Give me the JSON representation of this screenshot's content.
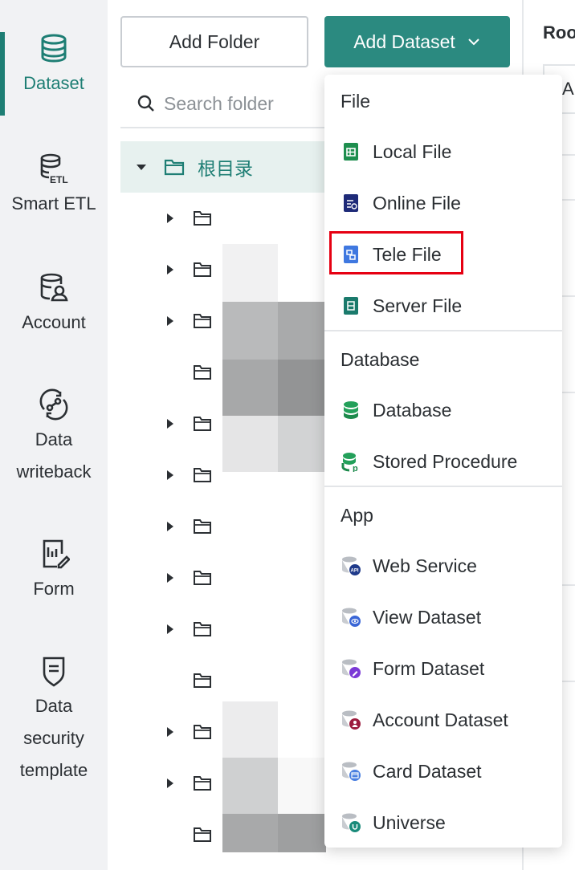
{
  "sidebar": {
    "items": [
      {
        "label": "Dataset",
        "icon": "database-icon",
        "active": true
      },
      {
        "label": "Smart ETL",
        "icon": "etl-icon"
      },
      {
        "label": "Account",
        "icon": "account-icon"
      },
      {
        "label": "Data writeback",
        "icon": "writeback-icon"
      },
      {
        "label": "Form",
        "icon": "form-icon"
      },
      {
        "label": "Data security template",
        "icon": "shield-icon"
      }
    ]
  },
  "toolbar": {
    "add_folder_label": "Add Folder",
    "add_dataset_label": "Add Dataset"
  },
  "search": {
    "placeholder": "Search folder"
  },
  "tree": {
    "root_label": "根目录"
  },
  "right_panel": {
    "title": "Roo",
    "field_fragment": "A"
  },
  "dropdown": {
    "groups": [
      {
        "title": "File",
        "items": [
          {
            "label": "Local File",
            "icon": "local-file-icon"
          },
          {
            "label": "Online File",
            "icon": "online-file-icon"
          },
          {
            "label": "Tele File",
            "icon": "tele-file-icon",
            "highlighted": true
          },
          {
            "label": "Server File",
            "icon": "server-file-icon"
          }
        ]
      },
      {
        "title": "Database",
        "items": [
          {
            "label": "Database",
            "icon": "database-icon"
          },
          {
            "label": "Stored Procedure",
            "icon": "stored-procedure-icon"
          }
        ]
      },
      {
        "title": "App",
        "items": [
          {
            "label": "Web Service",
            "icon": "web-service-icon"
          },
          {
            "label": "View Dataset",
            "icon": "view-dataset-icon"
          },
          {
            "label": "Form Dataset",
            "icon": "form-dataset-icon"
          },
          {
            "label": "Account Dataset",
            "icon": "account-dataset-icon"
          },
          {
            "label": "Card Dataset",
            "icon": "card-dataset-icon"
          },
          {
            "label": "Universe",
            "icon": "universe-icon"
          }
        ]
      }
    ]
  },
  "colors": {
    "accent": "#2b8a80",
    "accent_text": "#1e7e74",
    "highlight": "#e60012"
  }
}
